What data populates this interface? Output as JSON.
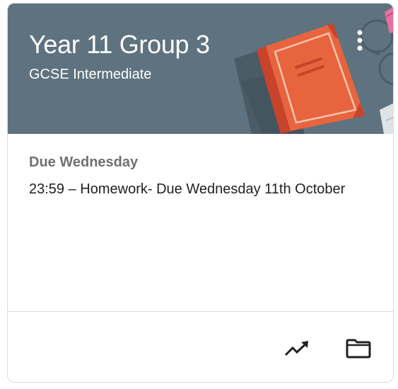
{
  "card": {
    "title": "Year 11 Group 3",
    "section": "GCSE Intermediate",
    "header_color": "#5e737f"
  },
  "upcoming": {
    "due_label": "Due Wednesday",
    "assignment": "23:59 – Homework- Due Wednesday 11th October"
  },
  "icons": {
    "menu": "more-vert-icon",
    "gradebook": "trending-up-icon",
    "drive": "folder-icon"
  }
}
